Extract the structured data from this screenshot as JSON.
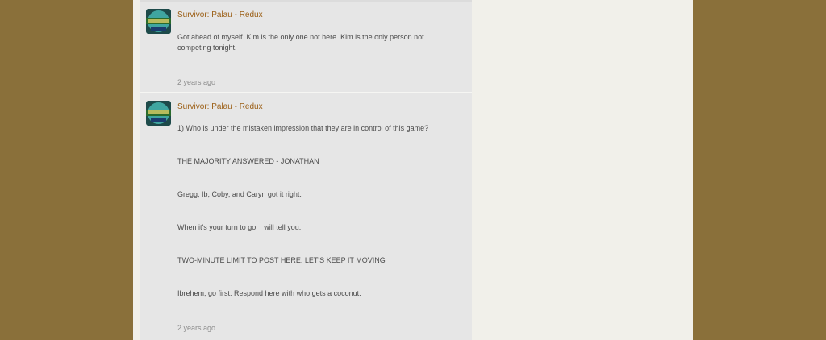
{
  "posts": [
    {
      "author": "Survivor: Palau - Redux",
      "avatar_icon": "survivor-palau-logo",
      "lines": [
        "Got ahead of myself.  Kim is the only one not here.  Kim is the only person not",
        "competing tonight."
      ],
      "timestamp": "2 years ago"
    },
    {
      "author": "Survivor: Palau - Redux",
      "avatar_icon": "survivor-palau-logo",
      "lines": [
        "1)  Who is under the mistaken impression that they are in control of this game?",
        "THE MAJORITY ANSWERED -  JONATHAN",
        "Gregg, Ib, Coby, and Caryn got it right.",
        "When it's your turn to go, I will tell you.",
        "TWO-MINUTE LIMIT TO POST HERE.  LET'S KEEP IT MOVING",
        "Ibrehem, go first.  Respond here with who gets a coconut."
      ],
      "timestamp": "2 years ago"
    }
  ],
  "colors": {
    "outer_background": "#8a703a",
    "page_background": "#f1f0ea",
    "post_background": "#e6e6e6",
    "author_color": "#9b5e14"
  }
}
